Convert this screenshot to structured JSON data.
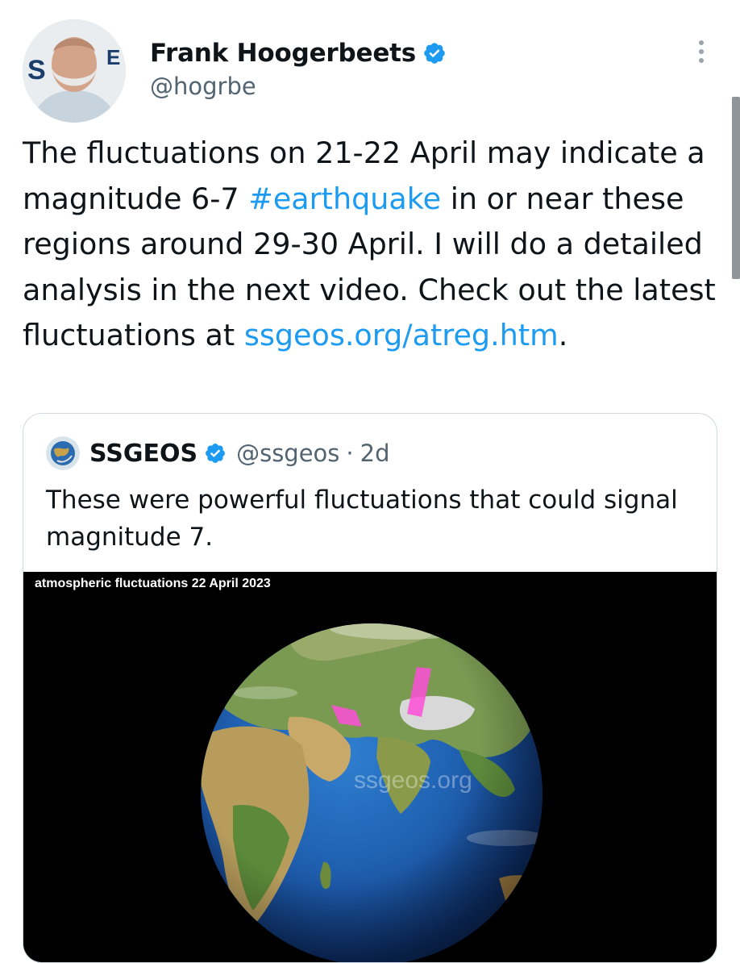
{
  "author": {
    "name": "Frank Hoogerbeets",
    "handle": "@hogrbe"
  },
  "tweet": {
    "text_1": "The fluctuations on 21-22 April may indicate a magnitude 6-7 ",
    "hashtag": "#earthquake",
    "text_2": " in or near these regions around 29-30 April. I will do a detailed analysis in the next video. Check out the latest fluctuations at ",
    "link": "ssgeos.org/atreg.htm",
    "text_3": "."
  },
  "quote": {
    "name": "SSGEOS",
    "handle": "@ssgeos",
    "separator": "·",
    "time": "2d",
    "text": "These were powerful fluctuations that could signal magnitude 7.",
    "media_caption": "atmospheric fluctuations 22 April 2023",
    "watermark": "ssgeos.org"
  },
  "colors": {
    "link": "#1d9bf0",
    "verified": "#1d9bf0",
    "highlight": "#ff4fd8"
  },
  "icons": {
    "verified": "verified-badge-icon",
    "more": "more-options-icon"
  }
}
